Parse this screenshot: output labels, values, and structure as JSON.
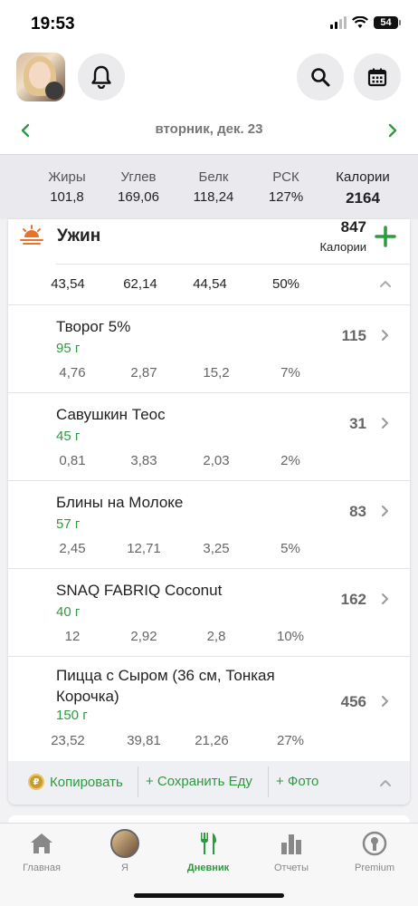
{
  "status": {
    "time": "19:53",
    "battery": "54"
  },
  "header": {
    "date": "вторник, дек. 23"
  },
  "summary": {
    "cols": [
      {
        "label": "Жиры",
        "value": "101,8"
      },
      {
        "label": "Углев",
        "value": "169,06"
      },
      {
        "label": "Белк",
        "value": "118,24"
      },
      {
        "label": "РСК",
        "value": "127%"
      },
      {
        "label": "Калории",
        "value": "2164"
      }
    ]
  },
  "meal": {
    "title": "Ужин",
    "calories": "847",
    "calories_label": "Калории",
    "macros": [
      "43,54",
      "62,14",
      "44,54",
      "50%"
    ]
  },
  "foods": [
    {
      "name": "Творог 5%",
      "qty": "95 г",
      "cal": "115",
      "macros": [
        "4,76",
        "2,87",
        "15,2",
        "7%"
      ]
    },
    {
      "name": "Савушкин Теос",
      "qty": "45 г",
      "cal": "31",
      "macros": [
        "0,81",
        "3,83",
        "2,03",
        "2%"
      ]
    },
    {
      "name": "Блины на Молоке",
      "qty": "57 г",
      "cal": "83",
      "macros": [
        "2,45",
        "12,71",
        "3,25",
        "5%"
      ]
    },
    {
      "name": "SNAQ FABRIQ Coconut",
      "qty": "40 г",
      "cal": "162",
      "macros": [
        "12",
        "2,92",
        "2,8",
        "10%"
      ]
    },
    {
      "name": "Пицца с Сыром (36 см, Тонкая Корочка)",
      "qty": "150 г",
      "cal": "456",
      "macros": [
        "23,52",
        "39,81",
        "21,26",
        "27%"
      ]
    }
  ],
  "actions": {
    "copy": "Копировать",
    "save": "+ Сохранить Еду",
    "photo": "+ Фото"
  },
  "tabs": [
    {
      "label": "Главная",
      "icon": "home-icon"
    },
    {
      "label": "Я",
      "icon": "avatar"
    },
    {
      "label": "Дневник",
      "icon": "fork-knife-icon"
    },
    {
      "label": "Отчеты",
      "icon": "bar-chart-icon"
    },
    {
      "label": "Premium",
      "icon": "premium-icon"
    }
  ],
  "colors": {
    "accent": "#2e9a3f",
    "gray": "#666666",
    "sun": "#e8742c"
  }
}
